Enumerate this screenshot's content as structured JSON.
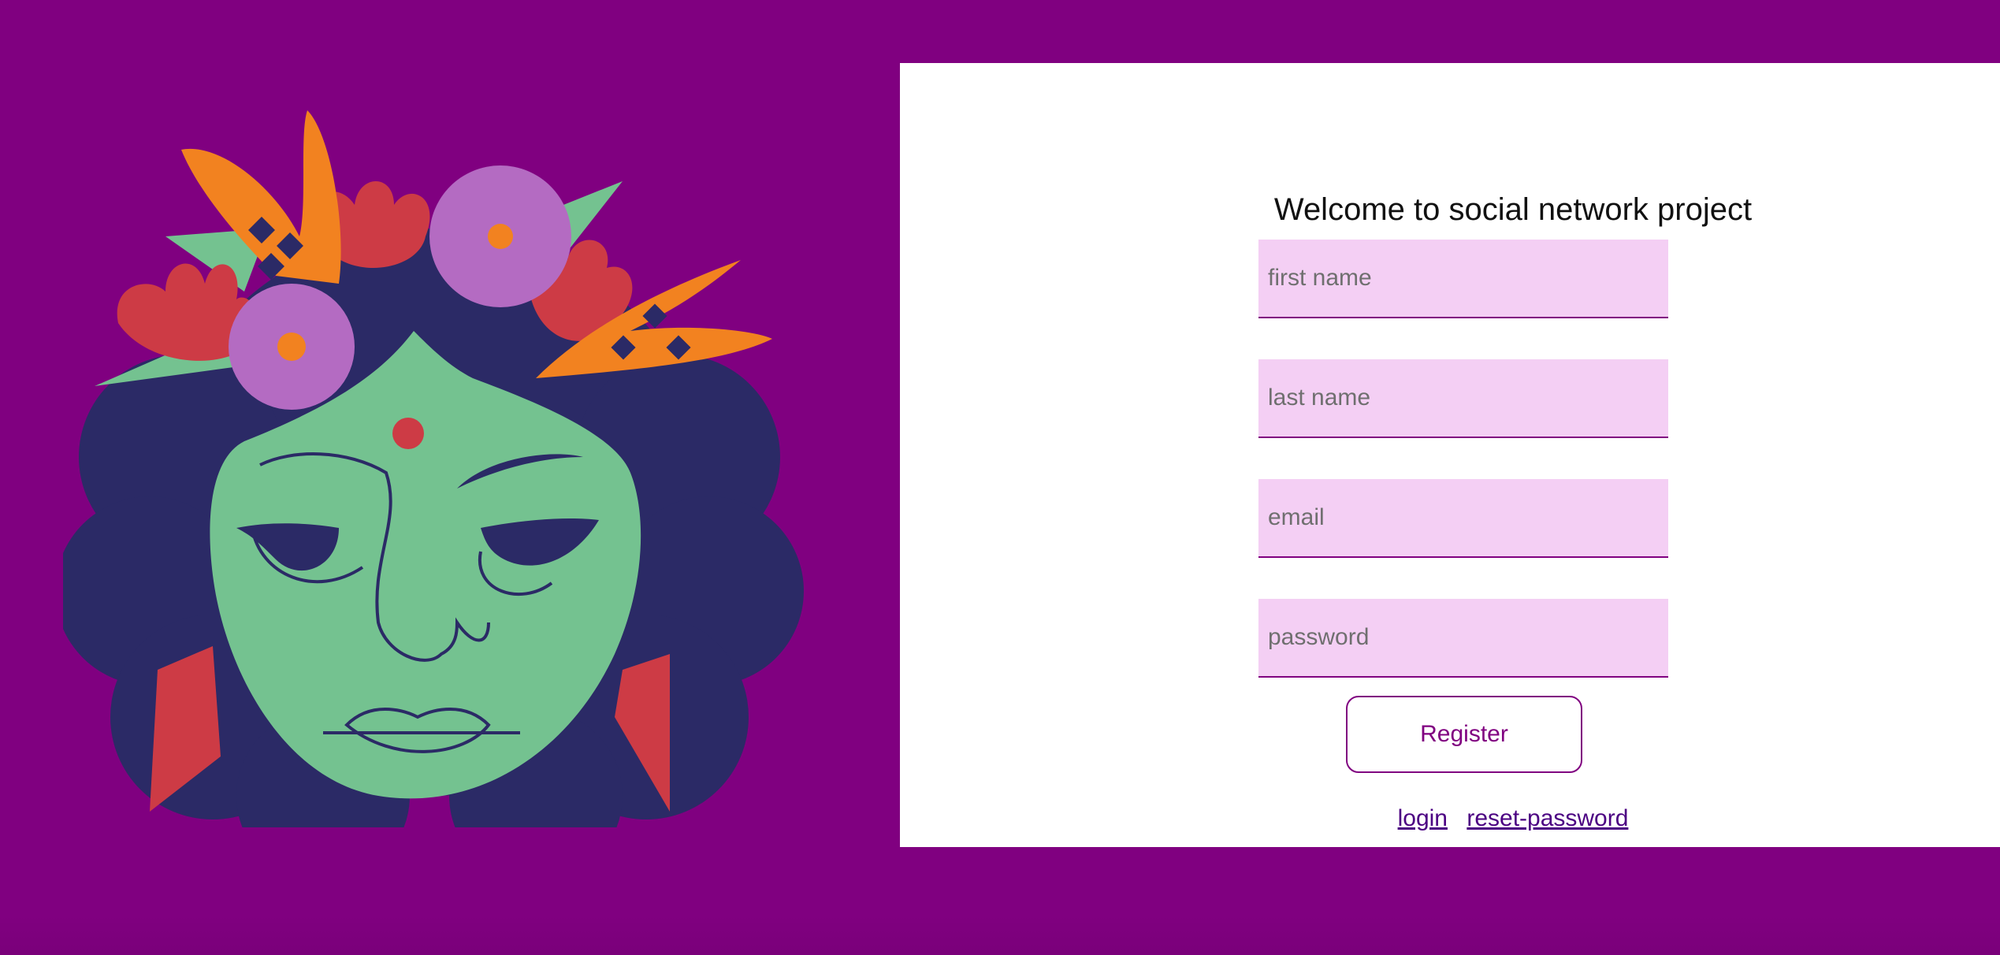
{
  "page": {
    "title": "Welcome to social network project"
  },
  "form": {
    "first_name_placeholder": "first name",
    "last_name_placeholder": "last name",
    "email_placeholder": "email",
    "password_placeholder": "password",
    "register_label": "Register"
  },
  "links": {
    "login_label": "login",
    "reset_label": "reset-password"
  },
  "colors": {
    "background": "#800080",
    "field_background": "#f4cff4",
    "accent": "#800080",
    "link": "#4b0082"
  }
}
